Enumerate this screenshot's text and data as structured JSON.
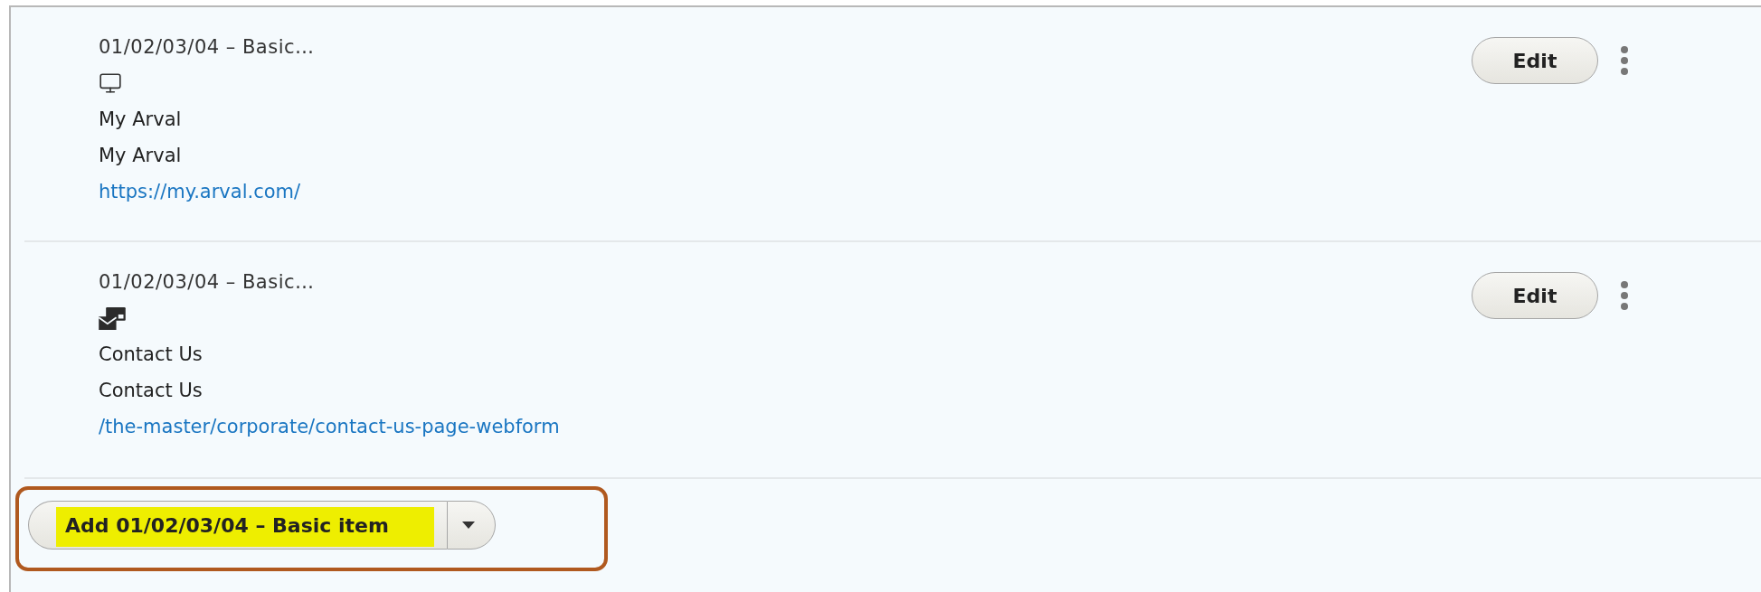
{
  "items": [
    {
      "title": "01/02/03/04 – Basic…",
      "kind": "monitor",
      "lines": [
        "My Arval",
        "My Arval"
      ],
      "link": "https://my.arval.com/",
      "edit_label": "Edit"
    },
    {
      "title": "01/02/03/04 – Basic…",
      "kind": "contact",
      "lines": [
        "Contact Us",
        "Contact Us"
      ],
      "link": "/the-master/corporate/contact-us-page-webform",
      "edit_label": "Edit"
    }
  ],
  "add_button": {
    "label": "Add 01/02/03/04 – Basic item",
    "highlighted": true,
    "framed": true
  }
}
